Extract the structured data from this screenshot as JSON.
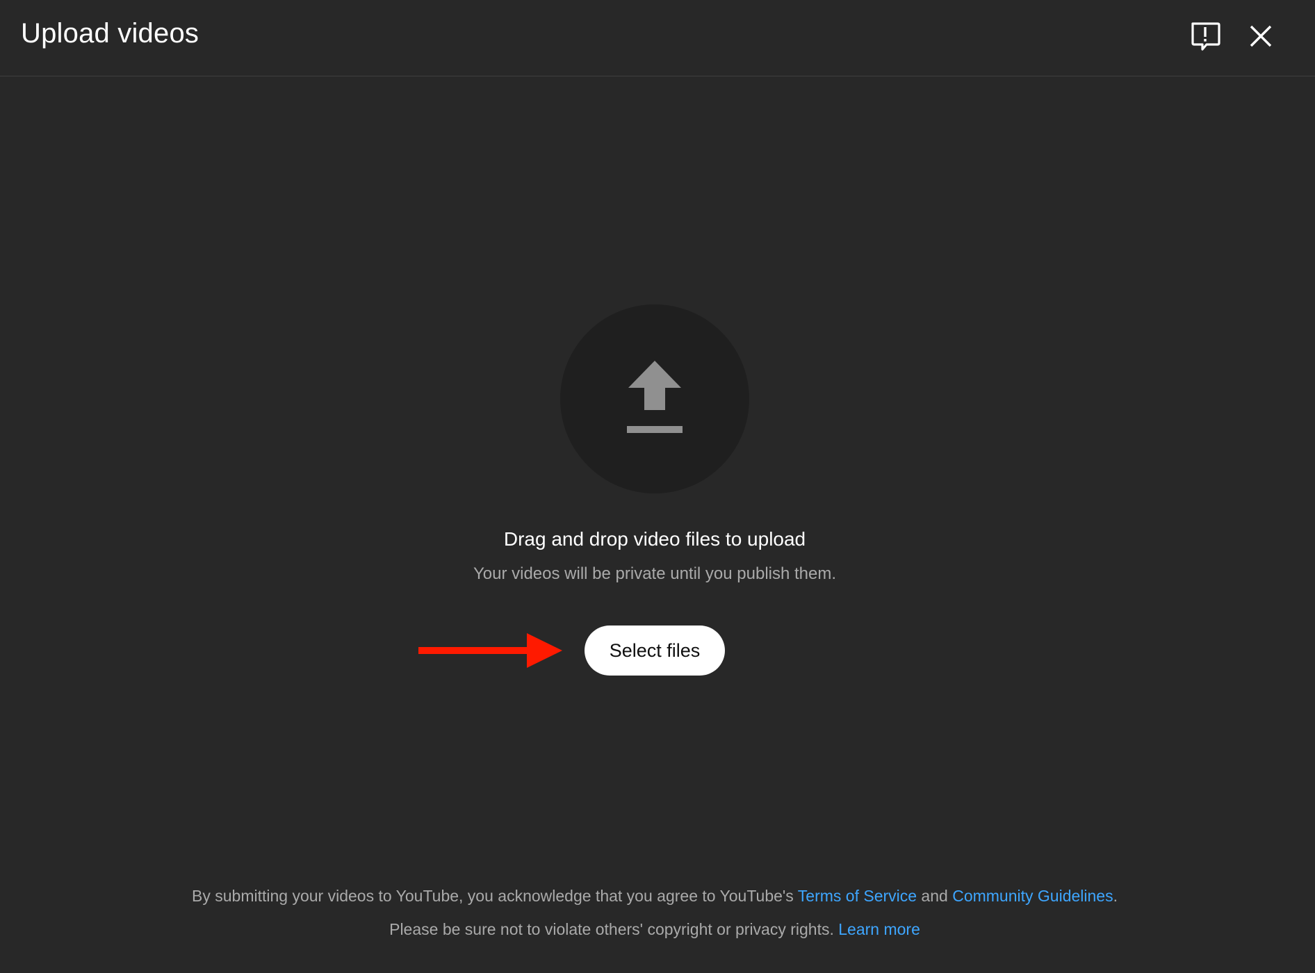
{
  "header": {
    "title": "Upload videos",
    "feedback_icon": "feedback-icon",
    "close_icon": "close-icon"
  },
  "upload": {
    "icon": "upload-arrow-icon",
    "drag_text": "Drag and drop video files to upload",
    "private_text": "Your videos will be private until you publish them.",
    "select_button_label": "Select files"
  },
  "annotation": {
    "arrow_color": "#ff1a00"
  },
  "footer": {
    "line1_prefix": "By submitting your videos to YouTube, you acknowledge that you agree to YouTube's ",
    "terms_link": "Terms of Service",
    "line1_and": " and ",
    "guidelines_link": "Community Guidelines",
    "line1_suffix": ".",
    "line2_prefix": "Please be sure not to violate others' copyright or privacy rights. ",
    "learn_more_link": "Learn more"
  },
  "colors": {
    "background": "#282828",
    "circle": "#1f1f1f",
    "link": "#3ea6ff",
    "button_bg": "#ffffff",
    "muted_text": "#aaaaaa"
  }
}
